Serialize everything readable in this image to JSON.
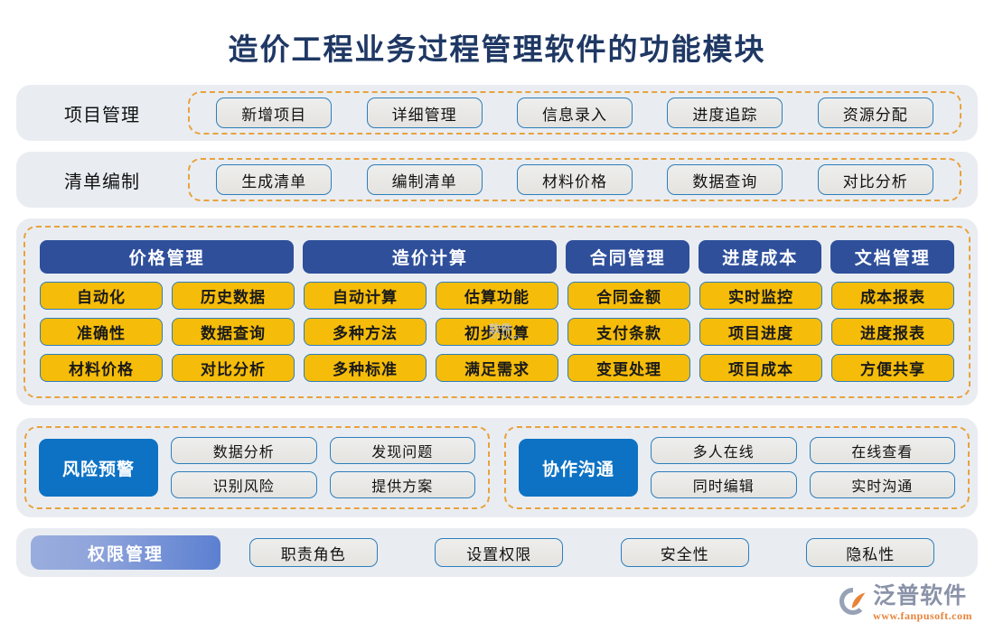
{
  "title": "造价工程业务过程管理软件的功能模块",
  "colors": {
    "title": "#1f3864",
    "panel_bg": "#e9edf2",
    "dashed_border": "#e9a23b",
    "header_blue": "#2f4f9b",
    "cell_yellow": "#f5bc09",
    "pill_border": "#2e7ebb",
    "block_blue": "#0d72c4",
    "logo_orange": "#e8833a"
  },
  "simple_rows": [
    {
      "label": "项目管理",
      "items": [
        "新增项目",
        "详细管理",
        "信息录入",
        "进度追踪",
        "资源分配"
      ]
    },
    {
      "label": "清单编制",
      "items": [
        "生成清单",
        "编制清单",
        "材料价格",
        "数据查询",
        "对比分析"
      ]
    }
  ],
  "matrix": {
    "headers": [
      {
        "label": "价格管理",
        "span": 2
      },
      {
        "label": "造价计算",
        "span": 2
      },
      {
        "label": "合同管理",
        "span": 1
      },
      {
        "label": "进度成本",
        "span": 1
      },
      {
        "label": "文档管理",
        "span": 1
      }
    ],
    "rows": [
      [
        "自动化",
        "历史数据",
        "自动计算",
        "估算功能",
        "合同金额",
        "实时监控",
        "成本报表"
      ],
      [
        "准确性",
        "数据查询",
        "多种方法",
        "初步预算",
        "支付条款",
        "项目进度",
        "进度报表"
      ],
      [
        "材料价格",
        "对比分析",
        "多种标准",
        "满足需求",
        "变更处理",
        "项目成本",
        "方便共享"
      ]
    ]
  },
  "duo": [
    {
      "title": "风险预警",
      "items": [
        "数据分析",
        "发现问题",
        "识别风险",
        "提供方案"
      ]
    },
    {
      "title": "协作沟通",
      "items": [
        "多人在线",
        "在线查看",
        "同时编辑",
        "实时沟通"
      ]
    }
  ],
  "permission": {
    "badge": "权限管理",
    "items": [
      "职责角色",
      "设置权限",
      "安全性",
      "隐私性"
    ]
  },
  "watermark": {
    "text": "软件",
    "sub": "SOFTWARE"
  },
  "logo": {
    "name": "泛普软件",
    "url": "www.fanpusoft.com"
  }
}
